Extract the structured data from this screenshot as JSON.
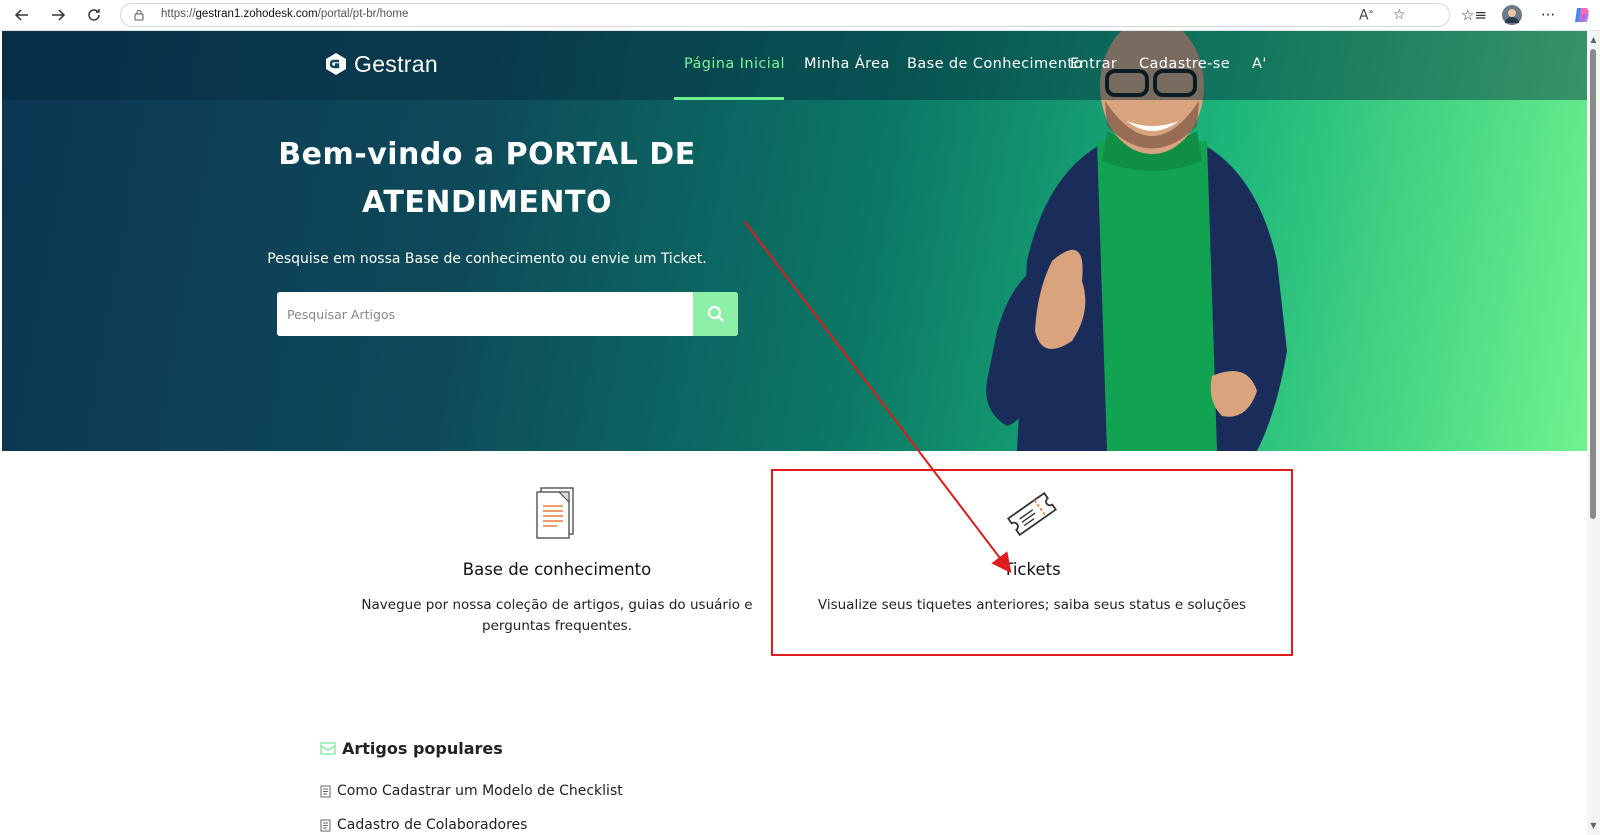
{
  "browser": {
    "url_prefix": "https://",
    "url_host": "gestran1.zohodesk.com",
    "url_path": "/portal/pt-br/home",
    "back_icon": "arrow-left-icon",
    "forward_icon": "arrow-right-icon",
    "reload_icon": "reload-icon",
    "read_aloud_icon": "read-aloud-icon",
    "favorite_icon": "star-icon",
    "menu_icon": "more-icon"
  },
  "header": {
    "logo_text": "Gestran",
    "nav": [
      {
        "label": "Página Inicial",
        "active": true
      },
      {
        "label": "Minha Área"
      },
      {
        "label": "Base de Conhecimento"
      },
      {
        "label": "Entrar"
      },
      {
        "label": "Cadastre-se"
      },
      {
        "label": "A'"
      }
    ]
  },
  "hero": {
    "title_line1": "Bem-vindo a PORTAL DE",
    "title_line2": "ATENDIMENTO",
    "subtitle": "Pesquise em nossa Base de conhecimento ou envie um Ticket.",
    "search_placeholder": "Pesquisar Artigos"
  },
  "cards": [
    {
      "title": "Base de conhecimento",
      "desc_line1": "Navegue por nossa coleção de artigos, guias do usuário e",
      "desc_line2": "perguntas frequentes."
    },
    {
      "title": "Tickets",
      "desc_line1": "Visualize seus tiquetes anteriores; saiba seus status e soluções"
    }
  ],
  "popular": {
    "title": "Artigos populares",
    "articles": [
      "Como Cadastrar um Modelo de Checklist",
      "Cadastro de Colaboradores"
    ]
  },
  "colors": {
    "accent_green": "#6ef08f",
    "annotation_red": "#e01b1b"
  }
}
